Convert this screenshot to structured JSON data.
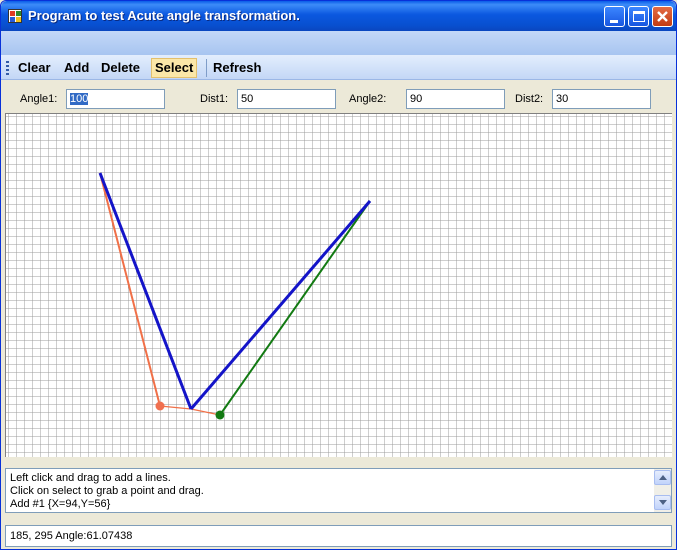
{
  "window": {
    "title": "Program to test Acute angle transformation."
  },
  "toolbar": {
    "items": [
      {
        "label": "Clear",
        "active": false
      },
      {
        "label": "Add",
        "active": false
      },
      {
        "label": "Delete",
        "active": false
      },
      {
        "label": "Select",
        "active": true
      },
      {
        "label": "Refresh",
        "active": false
      }
    ]
  },
  "params": {
    "angle1_label": "Angle1:",
    "angle1_value": "100",
    "dist1_label": "Dist1:",
    "dist1_value": "50",
    "angle2_label": "Angle2:",
    "angle2_value": "90",
    "dist2_label": "Dist2:",
    "dist2_value": "30"
  },
  "log": {
    "lines": [
      "Left click and drag to add a lines.",
      "Click on select to grab a point and drag.",
      "Add #1 {X=94,Y=56}"
    ]
  },
  "status": {
    "text": "185, 295 Angle:61.07438"
  },
  "colors": {
    "line_primary": "#1414c8",
    "line_orange": "#f07048",
    "line_green": "#127a12",
    "point_orange": "#f07050",
    "point_green": "#127a12",
    "grid": "#9c9c9c"
  },
  "icons": {
    "app": "app-form-icon",
    "minimize": "minimize-icon",
    "maximize": "maximize-icon",
    "close": "close-icon",
    "scroll_up": "scroll-up-icon",
    "scroll_down": "scroll-down-icon"
  }
}
